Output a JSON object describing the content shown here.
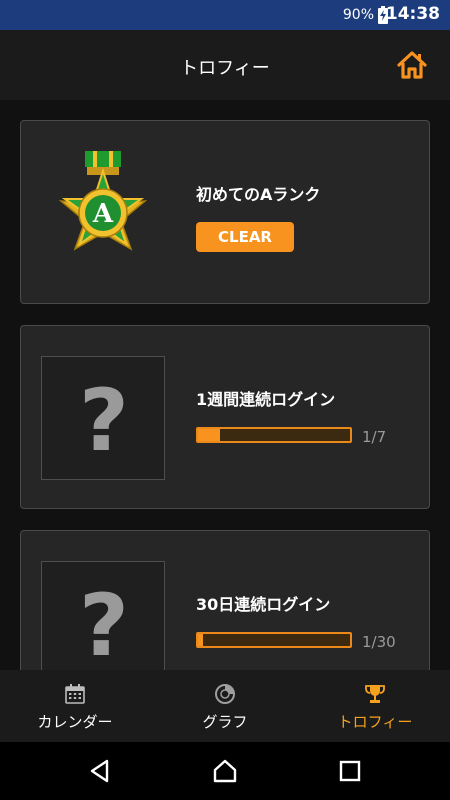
{
  "status_bar": {
    "battery_percent": "90%",
    "time": "14:38",
    "battery_icon": "battery-charging-icon"
  },
  "header": {
    "title": "トロフィー",
    "home_icon": "home-icon",
    "accent_color": "#f7931e"
  },
  "trophies": [
    {
      "title": "初めてのAランク",
      "status": "CLEAR",
      "icon": "medal-a-icon",
      "medal_letter": "A"
    },
    {
      "title": "1週間連続ログイン",
      "icon": "question-icon",
      "placeholder": "?",
      "progress_text": "1/7",
      "progress": 0.143
    },
    {
      "title": "30日連続ログイン",
      "icon": "question-icon",
      "placeholder": "?",
      "progress_text": "1/30",
      "progress": 0.033
    }
  ],
  "bottom_tabs": [
    {
      "label": "カレンダー",
      "icon": "calendar-icon",
      "active": false
    },
    {
      "label": "グラフ",
      "icon": "pie-chart-icon",
      "active": false
    },
    {
      "label": "トロフィー",
      "icon": "trophy-icon",
      "active": true
    }
  ],
  "system_nav": {
    "back_icon": "back-triangle-icon",
    "home_icon": "home-circle-icon",
    "recents_icon": "recents-square-icon"
  }
}
